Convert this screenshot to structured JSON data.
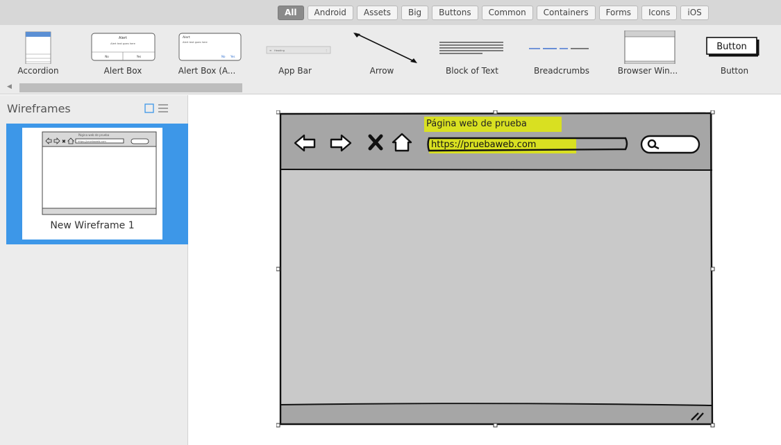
{
  "filter_bar": {
    "tabs": [
      "All",
      "Android",
      "Assets",
      "Big",
      "Buttons",
      "Common",
      "Containers",
      "Forms",
      "Icons",
      "iOS"
    ],
    "active_tab": "All"
  },
  "components": [
    {
      "label": "Accordion",
      "icon": "accordion-thumbnail"
    },
    {
      "label": "Alert Box",
      "icon": "alert-box-thumbnail"
    },
    {
      "label": "Alert Box (A...",
      "icon": "alert-box-alt-thumbnail"
    },
    {
      "label": "App Bar",
      "icon": "app-bar-thumbnail"
    },
    {
      "label": "Arrow",
      "icon": "arrow-thumbnail"
    },
    {
      "label": "Block of Text",
      "icon": "text-block-thumbnail"
    },
    {
      "label": "Breadcrumbs",
      "icon": "breadcrumbs-thumbnail"
    },
    {
      "label": "Browser Win...",
      "icon": "browser-window-thumbnail"
    },
    {
      "label": "Button",
      "icon": "button-thumbnail"
    }
  ],
  "component_thumbs": {
    "alert_title": "Alert",
    "alert_text": "Alert text goes here",
    "alert_no": "No",
    "alert_yes": "Yes",
    "app_bar_text": "Heading",
    "button_text": "Button"
  },
  "panel": {
    "title": "Wireframes",
    "wireframe_name": "New Wireframe 1"
  },
  "canvas": {
    "browser_title": "Página web de prueba",
    "browser_url": "https://pruebaweb.com"
  },
  "colors": {
    "accent_blue": "#3d97e8",
    "highlight_yellow": "#d9e021",
    "wireframe_gray": "#c9c9c9"
  }
}
